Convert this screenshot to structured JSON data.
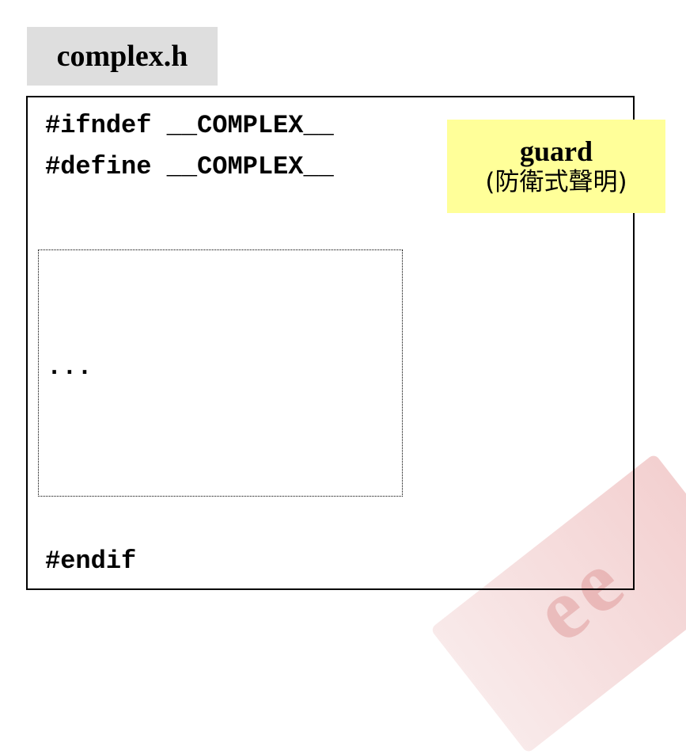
{
  "file_title": "complex.h",
  "code": {
    "ifndef": "#ifndef __COMPLEX__",
    "define": "#define __COMPLEX__",
    "ellipsis": "...",
    "endif": "#endif"
  },
  "callout": {
    "title": "guard",
    "subtitle": "(防衛式聲明)",
    "color": "#ffff99"
  },
  "watermark": {
    "text": "ee"
  },
  "colors": {
    "title_bg": "#dedede",
    "watermark": "#d98c8c"
  }
}
